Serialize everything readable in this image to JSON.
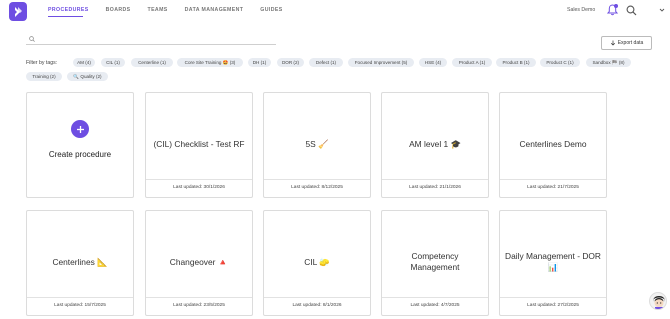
{
  "nav": {
    "items": [
      "PROCEDURES",
      "BOARDS",
      "TEAMS",
      "DATA MANAGEMENT",
      "GUIDES"
    ],
    "active": "PROCEDURES",
    "org_name": "Sales Demo",
    "accent": "#6e4ee2"
  },
  "search": {
    "placeholder": "",
    "value": ""
  },
  "export_label": "Export data",
  "filter": {
    "label": "Filter by tags:",
    "tags": [
      "AM (4)",
      "CIL (1)",
      "Centerline (1)",
      "Core Site Training 🤩 (3)",
      "DH (1)",
      "DOR (2)",
      "Defect (1)",
      "Focused Improvement (5)",
      "HSE (4)",
      "Product A (1)",
      "Product B (1)",
      "Product C (1)",
      "Sandbox 🏁 (8)",
      "Training (2)",
      "🔍 Quality (2)"
    ]
  },
  "create": {
    "label": "Create procedure"
  },
  "cards": [
    {
      "title": "(CIL) Checklist - Test RF",
      "updated": "Last updated: 30/1/2026"
    },
    {
      "title": "5S 🧹",
      "updated": "Last updated: 8/12/2025"
    },
    {
      "title": "AM level 1 🎓",
      "updated": "Last updated: 21/1/2026"
    },
    {
      "title": "Centerlines Demo",
      "updated": "Last updated: 21/7/2025"
    },
    {
      "title": "Centerlines 📐",
      "updated": "Last updated: 15/7/2025"
    },
    {
      "title": "Changeover 🔺",
      "updated": "Last updated: 23/5/2025"
    },
    {
      "title": "CIL 🧽",
      "updated": "Last updated: 8/1/2026"
    },
    {
      "title": "Competency Management",
      "updated": "Last updated: 4/7/2025"
    },
    {
      "title": "Daily Management - DOR 📊",
      "updated": "Last updated: 27/2/2025"
    }
  ]
}
